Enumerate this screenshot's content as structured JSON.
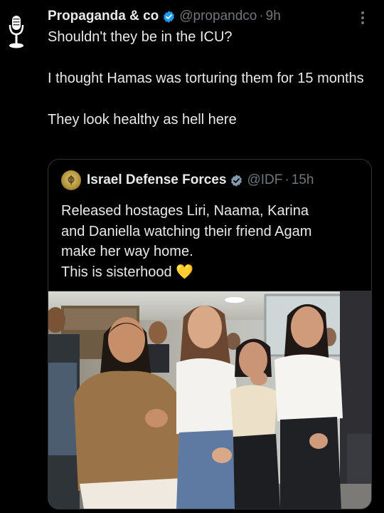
{
  "tweet": {
    "author_name": "Propaganda & co",
    "handle": "@propandco",
    "separator": "·",
    "time": "9h",
    "avatar_icon": "microphone-icon",
    "text_lines": [
      "Shouldn't they be in the ICU?",
      "I thought Hamas was torturing them for 15 months",
      "They look healthy as hell here"
    ]
  },
  "quote": {
    "author_name": "Israel Defense Forces",
    "handle": "@IDF",
    "separator": "·",
    "time": "15h",
    "avatar_icon": "idf-emblem-icon",
    "text_lines": [
      "Released hostages Liri, Naama, Karina",
      "and Daniella watching their friend Agam",
      "make her way home.",
      "This is sisterhood 💛"
    ]
  },
  "colors": {
    "background": "#000000",
    "text": "#e7e9ea",
    "muted": "#71767b",
    "verified_blue": "#1d9bf0",
    "verified_gray": "#829aab",
    "border": "#2f3336"
  },
  "icons": {
    "verified": "verified-badge-icon",
    "more": "more-options-icon"
  }
}
